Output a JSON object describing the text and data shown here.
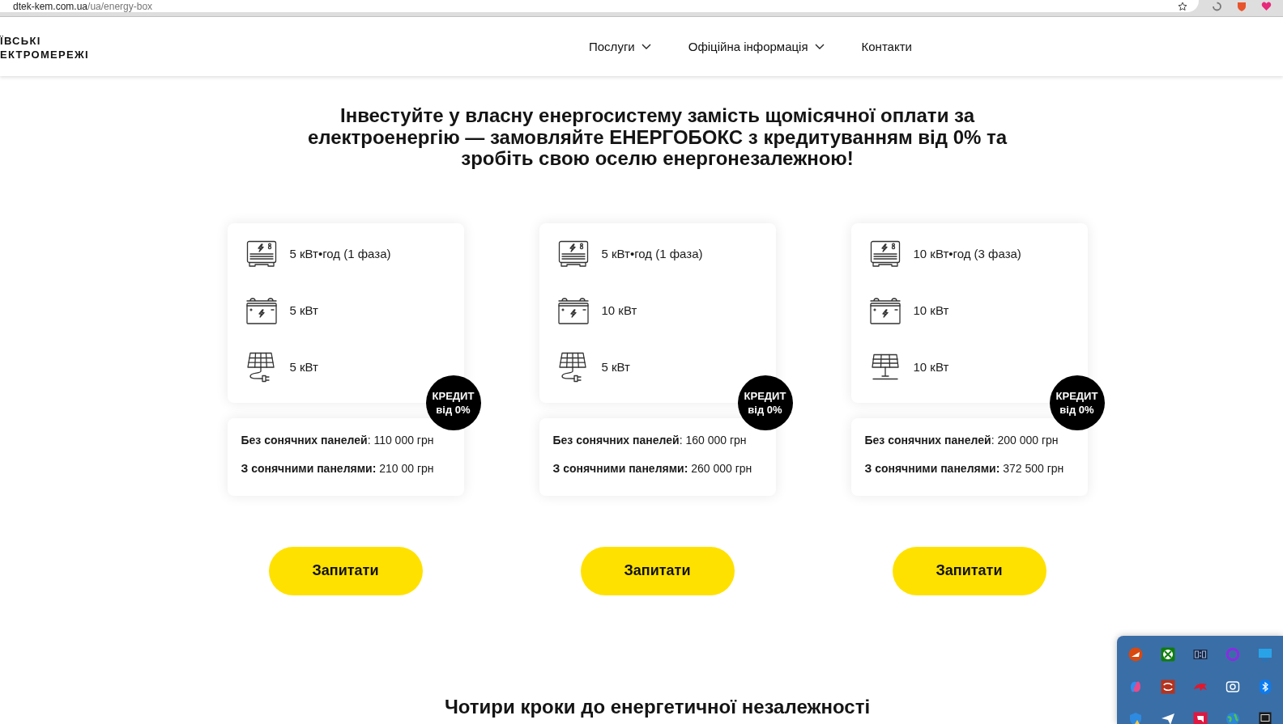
{
  "browser": {
    "url_host": "dtek-kem.com.ua",
    "url_path": "/ua/energy-box"
  },
  "header": {
    "logo_lines": [
      "ЇВСЬКІ",
      "ЕКТРОМЕРЕЖІ"
    ],
    "nav": [
      {
        "label": "Послуги",
        "kind": "dropdown"
      },
      {
        "label": "Офіційна інформація",
        "kind": "dropdown"
      },
      {
        "label": "Контакти",
        "kind": "link"
      }
    ]
  },
  "headline": "Інвестуйте у власну енергосистему замість щомісячної оплати за електроенергію — замовляйте ЕНЕРГОБОКС з кредитуванням від 0% та зробіть свою оселю енергонезалежною!",
  "offers": [
    {
      "specs": [
        {
          "kind": "inverter",
          "text": "5 кВт•год (1 фаза)"
        },
        {
          "kind": "battery",
          "text": "5 кВт"
        },
        {
          "kind": "solar-plug",
          "text": "5 кВт"
        }
      ],
      "badge_lines": [
        "КРЕДИТ",
        "від 0%"
      ],
      "prices": [
        "**Без сонячних панелей**: 110 000 грн",
        "**З сонячними панелями:** 210 00 грн"
      ],
      "button": "Запитати"
    },
    {
      "specs": [
        {
          "kind": "inverter",
          "text": "5 кВт•год (1 фаза)"
        },
        {
          "kind": "battery",
          "text": "10 кВт"
        },
        {
          "kind": "solar-plug",
          "text": "5 кВт"
        }
      ],
      "badge_lines": [
        "КРЕДИТ",
        "від 0%"
      ],
      "prices": [
        "**Без сонячних панелей**: 160 000 грн",
        "**З сонячними панелями:** 260 000 грн"
      ],
      "button": "Запитати"
    },
    {
      "specs": [
        {
          "kind": "inverter",
          "text": "10 кВт•год (3 фаза)"
        },
        {
          "kind": "battery",
          "text": "10 кВт"
        },
        {
          "kind": "solar-stand",
          "text": "10 кВт"
        }
      ],
      "badge_lines": [
        "КРЕДИТ",
        "від 0%"
      ],
      "prices": [
        "**Без сонячних панелей**: 200 000 грн",
        "**З сонячними панелями:** 372 500 грн"
      ],
      "button": "Запитати"
    }
  ],
  "section_title": "Чотири кроки до енергетичної незалежності"
}
